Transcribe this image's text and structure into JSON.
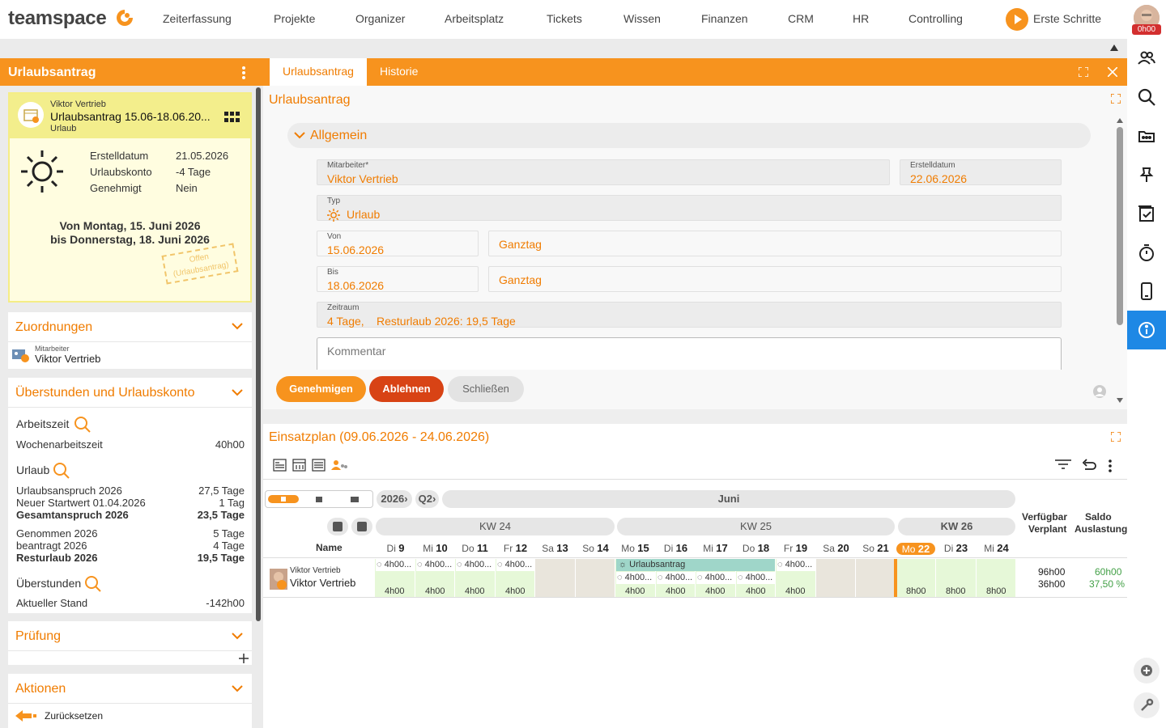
{
  "nav": {
    "logo": "teamspace",
    "items": [
      "Zeiterfassung",
      "Projekte",
      "Organizer",
      "Arbeitsplatz",
      "Tickets",
      "Wissen",
      "Finanzen",
      "CRM",
      "HR",
      "Controlling"
    ],
    "erste_schritte": "Erste Schritte",
    "avatar_badge": "0h00"
  },
  "left": {
    "header": "Urlaubsantrag",
    "card": {
      "owner": "Viktor Vertrieb",
      "title": "Urlaubsantrag 15.06-18.06.20...",
      "subtitle": "Urlaub",
      "rows": [
        {
          "label": "Erstelldatum",
          "value": "21.05.2026"
        },
        {
          "label": "Urlaubskonto",
          "value": "-4 Tage"
        },
        {
          "label": "Genehmigt",
          "value": "Nein"
        }
      ],
      "range_from": "Von Montag, 15. Juni 2026",
      "range_to": "bis Donnerstag, 18. Juni 2026",
      "stamp_1": "Offen",
      "stamp_2": "(Urlaubsantrag)"
    },
    "zuordnungen": {
      "title": "Zuordnungen",
      "label": "Mitarbeiter",
      "value": "Viktor Vertrieb"
    },
    "ueberstunden": {
      "title": "Überstunden und Urlaubskonto",
      "arbeitszeit": "Arbeitszeit",
      "wochen_label": "Wochenarbeitszeit",
      "wochen_value": "40h00",
      "urlaub": "Urlaub",
      "rows1": [
        {
          "label": "Urlaubsanspruch 2026",
          "value": "27,5 Tage"
        },
        {
          "label": "Neuer Startwert 01.04.2026",
          "value": "1 Tag"
        },
        {
          "label": "Gesamtanspruch 2026",
          "value": "23,5 Tage"
        }
      ],
      "rows2": [
        {
          "label": "Genommen 2026",
          "value": "5 Tage"
        },
        {
          "label": "beantragt 2026",
          "value": "4 Tage"
        },
        {
          "label": "Resturlaub 2026",
          "value": "19,5 Tage"
        }
      ],
      "ueberstunden": "Überstunden",
      "stand_label": "Aktueller Stand",
      "stand_value": "-142h00"
    },
    "pruefung": {
      "title": "Prüfung"
    },
    "aktionen": {
      "title": "Aktionen",
      "item": "Zurücksetzen"
    }
  },
  "main": {
    "tabs": [
      "Urlaubsantrag",
      "Historie"
    ],
    "title": "Urlaubsantrag",
    "section": "Allgemein",
    "fields": {
      "mitarbeiter_label": "Mitarbeiter*",
      "mitarbeiter": "Viktor Vertrieb",
      "erstelldatum_label": "Erstelldatum",
      "erstelldatum": "22.06.2026",
      "typ_label": "Typ",
      "typ": "Urlaub",
      "von_label": "Von",
      "von": "15.06.2026",
      "von_tag": "Ganztag",
      "bis_label": "Bis",
      "bis": "18.06.2026",
      "bis_tag": "Ganztag",
      "zeitraum_label": "Zeitraum",
      "zeitraum_days": "4 Tage,",
      "zeitraum_rest": "Resturlaub 2026: 19,5 Tage",
      "kommentar_placeholder": "Kommentar"
    },
    "buttons": {
      "approve": "Genehmigen",
      "reject": "Ablehnen",
      "close": "Schließen"
    }
  },
  "planner": {
    "title": "Einsatzplan (09.06.2026 - 24.06.2026)",
    "year": "2026",
    "quarter": "Q2",
    "month": "Juni",
    "weeks": [
      "KW 24",
      "KW 25",
      "KW 26"
    ],
    "name_header": "Name",
    "col_verf": "Verfügbar",
    "col_verplant": "Verplant",
    "col_saldo": "Saldo",
    "col_auslastung": "Auslastung",
    "days": [
      {
        "wd": "Di",
        "d": "9"
      },
      {
        "wd": "Mi",
        "d": "10"
      },
      {
        "wd": "Do",
        "d": "11"
      },
      {
        "wd": "Fr",
        "d": "12"
      },
      {
        "wd": "Sa",
        "d": "13"
      },
      {
        "wd": "So",
        "d": "14"
      },
      {
        "wd": "Mo",
        "d": "15"
      },
      {
        "wd": "Di",
        "d": "16"
      },
      {
        "wd": "Mi",
        "d": "17"
      },
      {
        "wd": "Do",
        "d": "18"
      },
      {
        "wd": "Fr",
        "d": "19"
      },
      {
        "wd": "Sa",
        "d": "20"
      },
      {
        "wd": "So",
        "d": "21"
      },
      {
        "wd": "Mo",
        "d": "22"
      },
      {
        "wd": "Di",
        "d": "23"
      },
      {
        "wd": "Mi",
        "d": "24"
      }
    ],
    "person_sub": "Viktor Vertrieb",
    "person": "Viktor Vertrieb",
    "chip": "4h00...",
    "hours_4": "4h00",
    "hours_8": "8h00",
    "bar_label": "Urlaubsantrag",
    "verfuegbar": "96h00",
    "verplant": "36h00",
    "saldo": "60h00",
    "auslastung": "37,50 %"
  },
  "colors": {
    "accent": "#f7931e",
    "text_accent": "#f07c00",
    "reject": "#d84315",
    "info": "#1e88e5"
  }
}
